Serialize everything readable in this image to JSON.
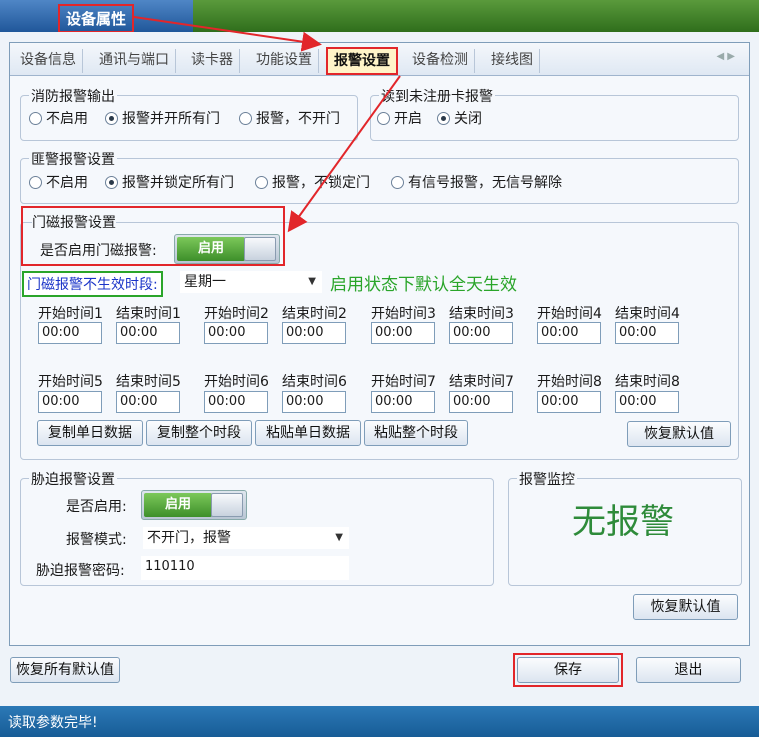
{
  "window": {
    "title": "设备属性"
  },
  "tabs": [
    "设备信息",
    "通讯与端口",
    "读卡器",
    "功能设置",
    "报警设置",
    "设备检测",
    "接线图"
  ],
  "fire_alarm": {
    "legend": "消防报警输出",
    "options": [
      "不启用",
      "报警并开所有门",
      "报警，不开门"
    ],
    "selected": 1
  },
  "unreg_card": {
    "legend": "读到未注册卡报警",
    "options": [
      "开启",
      "关闭"
    ],
    "selected": 1
  },
  "intrusion": {
    "legend": "匪警报警设置",
    "options": [
      "不启用",
      "报警并锁定所有门",
      "报警，不锁定门",
      "有信号报警，无信号解除"
    ],
    "selected": 1
  },
  "door_mag": {
    "legend": "门磁报警设置",
    "enable_label": "是否启用门磁报警:",
    "toggle_label": "启用",
    "ineffective_label": "门磁报警不生效时段:",
    "weekday": "星期一",
    "note": "启用状态下默认全天生效",
    "note_color": "#2aa52a",
    "slots_row1": [
      {
        "label": "开始时间1",
        "value": "00:00"
      },
      {
        "label": "结束时间1",
        "value": "00:00"
      },
      {
        "label": "开始时间2",
        "value": "00:00"
      },
      {
        "label": "结束时间2",
        "value": "00:00"
      },
      {
        "label": "开始时间3",
        "value": "00:00"
      },
      {
        "label": "结束时间3",
        "value": "00:00"
      },
      {
        "label": "开始时间4",
        "value": "00:00"
      },
      {
        "label": "结束时间4",
        "value": "00:00"
      }
    ],
    "slots_row2": [
      {
        "label": "开始时间5",
        "value": "00:00"
      },
      {
        "label": "结束时间5",
        "value": "00:00"
      },
      {
        "label": "开始时间6",
        "value": "00:00"
      },
      {
        "label": "结束时间6",
        "value": "00:00"
      },
      {
        "label": "开始时间7",
        "value": "00:00"
      },
      {
        "label": "结束时间7",
        "value": "00:00"
      },
      {
        "label": "开始时间8",
        "value": "00:00"
      },
      {
        "label": "结束时间8",
        "value": "00:00"
      }
    ],
    "buttons": [
      "复制单日数据",
      "复制整个时段",
      "粘贴单日数据",
      "粘贴整个时段"
    ],
    "restore": "恢复默认值"
  },
  "duress": {
    "legend": "胁迫报警设置",
    "enable_label": "是否启用:",
    "toggle_label": "启用",
    "mode_label": "报警模式:",
    "mode_value": "不开门，报警",
    "pwd_label": "胁迫报警密码:",
    "pwd_value": "110110"
  },
  "monitor": {
    "legend": "报警监控",
    "status": "无报警",
    "status_color": "#2e8b3a"
  },
  "restore_default": "恢复默认值",
  "footer": {
    "restore_all": "恢复所有默认值",
    "save": "保存",
    "exit": "退出"
  },
  "status_bar": "读取参数完毕!",
  "accent_color": "#e2262a"
}
